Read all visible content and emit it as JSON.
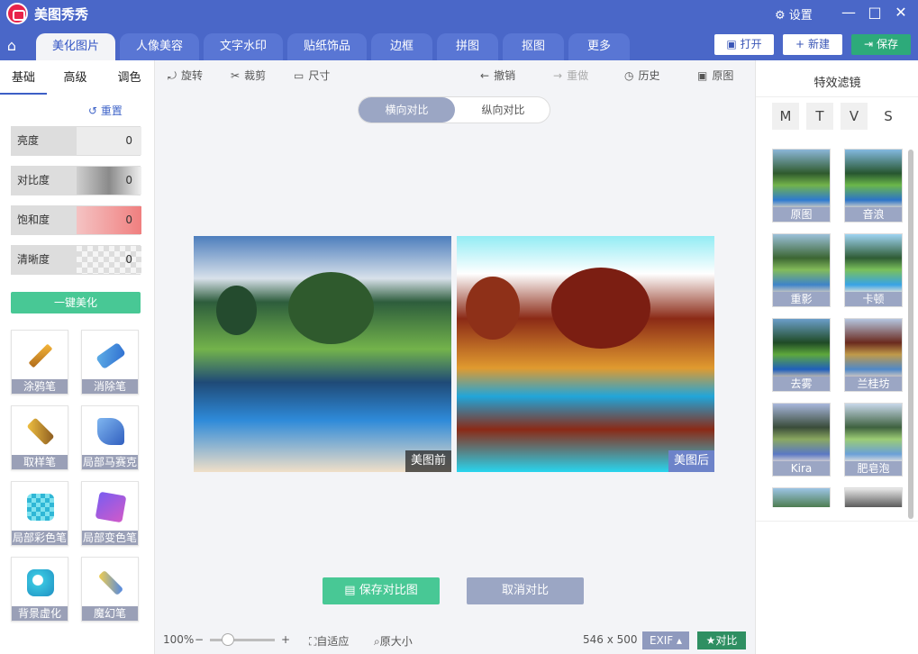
{
  "app": {
    "title": "美图秀秀",
    "settings_label": "设置",
    "min_icon": "minimize-icon",
    "max_icon": "maximize-icon",
    "close_icon": "close-icon"
  },
  "nav": {
    "tabs": [
      {
        "label": "美化图片",
        "active": true
      },
      {
        "label": "人像美容"
      },
      {
        "label": "文字水印"
      },
      {
        "label": "贴纸饰品"
      },
      {
        "label": "边框"
      },
      {
        "label": "拼图"
      },
      {
        "label": "抠图"
      },
      {
        "label": "更多"
      }
    ],
    "open_label": "打开",
    "new_label": "新建",
    "save_label": "保存"
  },
  "left": {
    "tabs": [
      "基础",
      "高级",
      "调色"
    ],
    "reset_label": "重置",
    "sliders": [
      {
        "label": "亮度",
        "value": "0"
      },
      {
        "label": "对比度",
        "value": "0"
      },
      {
        "label": "饱和度",
        "value": "0"
      },
      {
        "label": "清晰度",
        "value": "0"
      }
    ],
    "one_key_label": "一键美化",
    "tools": [
      "涂鸦笔",
      "消除笔",
      "取样笔",
      "局部马赛克",
      "局部彩色笔",
      "局部变色笔",
      "背景虚化",
      "魔幻笔"
    ]
  },
  "toolbar": {
    "rotate": "旋转",
    "crop": "裁剪",
    "size": "尺寸",
    "undo": "撤销",
    "redo": "重做",
    "history": "历史",
    "original": "原图"
  },
  "compare": {
    "horizontal": "横向对比",
    "vertical": "纵向对比",
    "before_caption": "美图前",
    "after_caption": "美图后",
    "save_button": "保存对比图",
    "cancel_button": "取消对比"
  },
  "status": {
    "zoom": "100%",
    "fit": "自适应",
    "actual_size": "原大小",
    "dimensions": "546 x 500",
    "exif": "EXIF",
    "compare": "对比"
  },
  "right": {
    "title": "特效滤镜",
    "sizes": [
      "M",
      "T",
      "V",
      "S"
    ],
    "filters": [
      "原图",
      "音浪",
      "重影",
      "卡顿",
      "去雾",
      "兰桂坊",
      "Kira",
      "肥皂泡"
    ]
  },
  "colors": {
    "titlebar": "#4a67c8",
    "accent_green": "#48c895",
    "accent_blue": "#3d5fc6",
    "label_gray": "#9ba6c4"
  }
}
